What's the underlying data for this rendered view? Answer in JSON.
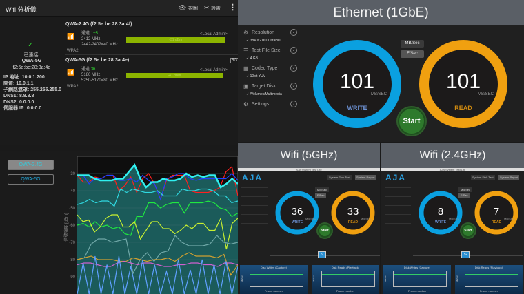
{
  "app": {
    "title": "Wifi 分析儀",
    "view_label": "視圖",
    "settings_label": "設置",
    "connected_label": "已連接:",
    "ssid": "QWA-5G",
    "bssid": "f2:5e:be:28:3a:4e",
    "info": [
      "IP 地址: 10.0.1.200",
      "閘道: 10.0.1.1",
      "子網路遮罩: 255.255.255.0",
      "DNS1: 8.8.8.8",
      "DNS2: 0.0.0.0",
      "伺服器 IP: 0.0.0.0"
    ],
    "networks": [
      {
        "name": "QWA-2.4G (f2:5e:be:28:3a:4f)",
        "channel_label": "通道",
        "channel": "1+5",
        "freq": "2412 MHz",
        "range": "2442-2402=40 MHz",
        "security": "WPA2",
        "vendor": "<Local Admin>",
        "signal": "-31 dBm",
        "signal_pct": 78,
        "badge": ""
      },
      {
        "name": "QWA-5G (f2:5e:be:28:3a:4e)",
        "channel_label": "通道",
        "channel": "36",
        "freq": "5180 MHz",
        "range": "5250-5170=80 MHz",
        "security": "WPA2",
        "vendor": "<Local Admin>",
        "signal": "-41 dBm",
        "signal_pct": 76,
        "badge": "5G"
      }
    ],
    "filters": [
      "QWA-2.4G",
      "QWA-5G"
    ]
  },
  "chart_data": {
    "type": "line",
    "ylabel": "信號強度 [dBm]",
    "yticks": [
      "-30",
      "-40",
      "-50",
      "-60",
      "-70",
      "-80",
      "-90"
    ],
    "ylim": [
      -100,
      -20
    ],
    "grid": true,
    "series": [
      {
        "color": "#ff2020",
        "values": [
          -31,
          -35,
          -35,
          -32,
          -33,
          -31,
          -31,
          -40,
          -37,
          -32,
          -41,
          -33,
          -30,
          -36,
          -45,
          -34,
          -31,
          -31,
          -31,
          -40,
          -41,
          -41,
          -41,
          -40,
          -38,
          -29,
          -26,
          -43
        ]
      },
      {
        "color": "#2040ff",
        "values": [
          -31,
          -31,
          -36,
          -33,
          -33,
          -31,
          -31,
          -34,
          -34,
          -33,
          -35,
          -31,
          -34,
          -36,
          -45,
          -33,
          -32,
          -30,
          -30,
          -33,
          -34,
          -33,
          -33,
          -33,
          -33,
          -33,
          -30,
          -34
        ]
      },
      {
        "color": "#30f0f0",
        "values": [
          -31,
          -31,
          -31,
          -33,
          -34,
          -34,
          -34,
          -33,
          -33,
          -29,
          -25,
          -33,
          -38,
          -35,
          -35,
          -33,
          -34,
          -34,
          -33,
          -30,
          -32,
          -31,
          -32,
          -31,
          -31,
          -38,
          -36,
          -33,
          -36
        ]
      },
      {
        "color": "#30d8e0",
        "values": [
          -48,
          -47,
          -45,
          -47,
          -46,
          -46,
          -49,
          -39,
          -41,
          -39,
          -40,
          -41,
          -41,
          -40,
          -43,
          -43,
          -43,
          -39,
          -40,
          -40,
          -39,
          -39,
          -40,
          -43,
          -43,
          -47,
          -46
        ]
      },
      {
        "color": "#20e840",
        "values": [
          -60,
          -59,
          -61,
          -58,
          -61,
          -60,
          -62,
          -61,
          -65,
          -66,
          -55,
          -55,
          -47,
          -47,
          -50,
          -48,
          -47,
          -47,
          -53,
          -47,
          -47,
          -47,
          -46,
          -47,
          -50,
          -51,
          -55,
          -53
        ]
      },
      {
        "color": "#c8f030",
        "values": [
          -54,
          -58,
          -57,
          -64,
          -61,
          -56,
          -54,
          -54,
          -61,
          -61,
          -58,
          -68,
          -63,
          -58,
          -58,
          -62,
          -62,
          -65,
          -63,
          -60,
          -62,
          -59,
          -59,
          -63,
          -63,
          -56,
          -74,
          -59,
          -56
        ]
      },
      {
        "color": "#70a8a8",
        "values": [
          -80,
          -79,
          -71,
          -68,
          -68,
          -70,
          -69,
          -68,
          -88,
          -80,
          -76,
          -81,
          -76,
          -75,
          -66,
          -70,
          -72,
          -72,
          -72,
          -71,
          -66,
          -70,
          -71,
          -70
        ]
      },
      {
        "color": "#d0a030",
        "values": [
          -80,
          -79,
          -78,
          -80,
          -80,
          -80,
          -81,
          -81,
          -79,
          -80,
          -81,
          -80,
          -80,
          -79,
          -81,
          -78,
          -76,
          -78,
          -78,
          -78,
          -79,
          -77,
          -89,
          -83
        ]
      },
      {
        "color": "#d060d0",
        "values": [
          -83,
          -82,
          -82,
          -83,
          -84,
          -84,
          -82,
          -81,
          -82,
          -83,
          -82,
          -82,
          -83,
          -84,
          -84,
          -83,
          -83,
          -82,
          -82,
          -83,
          -83,
          -84,
          -82,
          -82,
          -83
        ]
      },
      {
        "color": "#60a0ff",
        "values": [
          -100,
          -82,
          -100,
          -78,
          -100,
          -83,
          -100,
          -78,
          -100,
          -84,
          -100,
          -80,
          -100,
          -83,
          -100,
          -87,
          -100,
          -80,
          -100,
          -86,
          -100,
          -80,
          -100,
          -83,
          -100,
          -81,
          -100,
          -84
        ]
      }
    ]
  },
  "ethernet": {
    "title": "Ethernet (1GbE)",
    "settings": [
      {
        "label": "Resolution",
        "value": "3840x2160 UltraHD"
      },
      {
        "label": "Test File Size",
        "value": "4 GB"
      },
      {
        "label": "Codec Type",
        "value": "10bit YUV"
      },
      {
        "label": "Target Disk",
        "value": "/Volumes/Multimedia"
      },
      {
        "label": "Settings",
        "value": ""
      }
    ],
    "unit_buttons": [
      "MB/Sec",
      "F/Sec"
    ],
    "write": "101",
    "read": "101",
    "unit": "MB/SEC",
    "write_label": "WRITE",
    "read_label": "READ",
    "start": "Start",
    "write_color": "#0aa0e0",
    "read_color": "#f0a010"
  },
  "wifi5": {
    "title": "Wifi (5GHz)",
    "window_title": "AJA System Test Lite",
    "logo": "AJA",
    "write": "36",
    "read": "33",
    "unit": "MB/SEC",
    "write_label": "WRITE",
    "read_label": "READ",
    "start": "Start",
    "btn1": "System Disk Test",
    "btn2": "System Report",
    "unit_buttons": [
      "MB/Sec",
      "F/Sec"
    ],
    "chart1": "Disk Writes (Capture)",
    "chart2": "Disk Reads (Playback)",
    "xlabel": "Frame number",
    "ylabel": "MB/sec"
  },
  "wifi24": {
    "title": "Wifi (2.4GHz)",
    "window_title": "AJA System Test Lite",
    "logo": "AJA",
    "write": "8",
    "read": "7",
    "unit": "MB/SEC",
    "write_label": "WRITE",
    "read_label": "READ",
    "start": "Start",
    "btn1": "System Disk Test",
    "btn2": "System Report",
    "unit_buttons": [
      "MB/Sec",
      "F/Sec"
    ],
    "chart1": "Disk Writes (Capture)",
    "chart2": "Disk Reads (Playback)",
    "xlabel": "Frame number",
    "ylabel": "MB/sec"
  }
}
